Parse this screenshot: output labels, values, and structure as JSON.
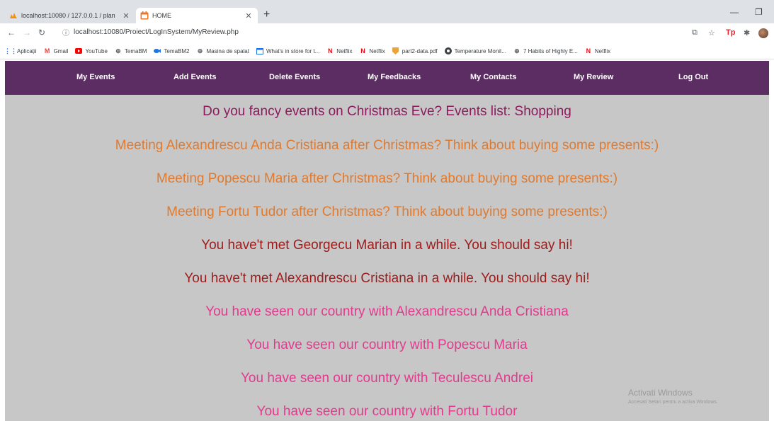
{
  "browser": {
    "tabs": [
      {
        "title": "localhost:10080 / 127.0.0.1 / plan",
        "active": false
      },
      {
        "title": "HOME",
        "active": true
      }
    ],
    "url": "localhost:10080/Proiect/LogInSystem/MyReview.php",
    "bookmarks": [
      {
        "label": "Aplicații",
        "icon": "apps-grid-icon"
      },
      {
        "label": "Gmail",
        "icon": "gmail-icon"
      },
      {
        "label": "YouTube",
        "icon": "youtube-icon"
      },
      {
        "label": "TemaBM",
        "icon": "globe-icon"
      },
      {
        "label": "TemaBM2",
        "icon": "fish-icon"
      },
      {
        "label": "Masina de spalat",
        "icon": "globe-icon"
      },
      {
        "label": "What's in store for t...",
        "icon": "window-icon"
      },
      {
        "label": "Netflix",
        "icon": "netflix-icon"
      },
      {
        "label": "Netflix",
        "icon": "netflix-icon"
      },
      {
        "label": "part2-data.pdf",
        "icon": "shield-icon"
      },
      {
        "label": "Temperature Monit...",
        "icon": "circle-icon"
      },
      {
        "label": "7 Habits of Highly E...",
        "icon": "globe-icon"
      },
      {
        "label": "Netflix",
        "icon": "netflix-icon"
      }
    ],
    "colors": {
      "tabstrip": "#dee1e6",
      "netflix": "#e50914"
    }
  },
  "nav": {
    "items": [
      {
        "label": "My Events"
      },
      {
        "label": "Add Events"
      },
      {
        "label": "Delete Events"
      },
      {
        "label": "My Feedbacks"
      },
      {
        "label": "My Contacts"
      },
      {
        "label": "My Review"
      },
      {
        "label": "Log Out"
      }
    ],
    "background": "#5c2d62"
  },
  "messages": [
    {
      "text": "Do you fancy events on Christmas Eve? Events list: Shopping",
      "color": "#8e1a5e"
    },
    {
      "text": "Meeting Alexandrescu Anda Cristiana after Christmas? Think about buying some presents:)",
      "color": "#e07a2e"
    },
    {
      "text": "Meeting Popescu Maria after Christmas? Think about buying some presents:)",
      "color": "#e07a2e"
    },
    {
      "text": "Meeting Fortu Tudor after Christmas? Think about buying some presents:)",
      "color": "#e07a2e"
    },
    {
      "text": "You have't met Georgecu Marian in a while. You should say hi!",
      "color": "#9e1b1b"
    },
    {
      "text": "You have't met Alexandrescu Cristiana in a while. You should say hi!",
      "color": "#9e1b1b"
    },
    {
      "text": "You have seen our country with Alexandrescu Anda Cristiana",
      "color": "#e33a8e"
    },
    {
      "text": "You have seen our country with Popescu Maria",
      "color": "#e33a8e"
    },
    {
      "text": "You have seen our country with Teculescu Andrei",
      "color": "#e33a8e"
    },
    {
      "text": "You have seen our country with Fortu Tudor",
      "color": "#e33a8e"
    }
  ],
  "watermark": {
    "line1": "Activati Windows",
    "line2": "Accesati Setari pentru a activa Windows."
  }
}
